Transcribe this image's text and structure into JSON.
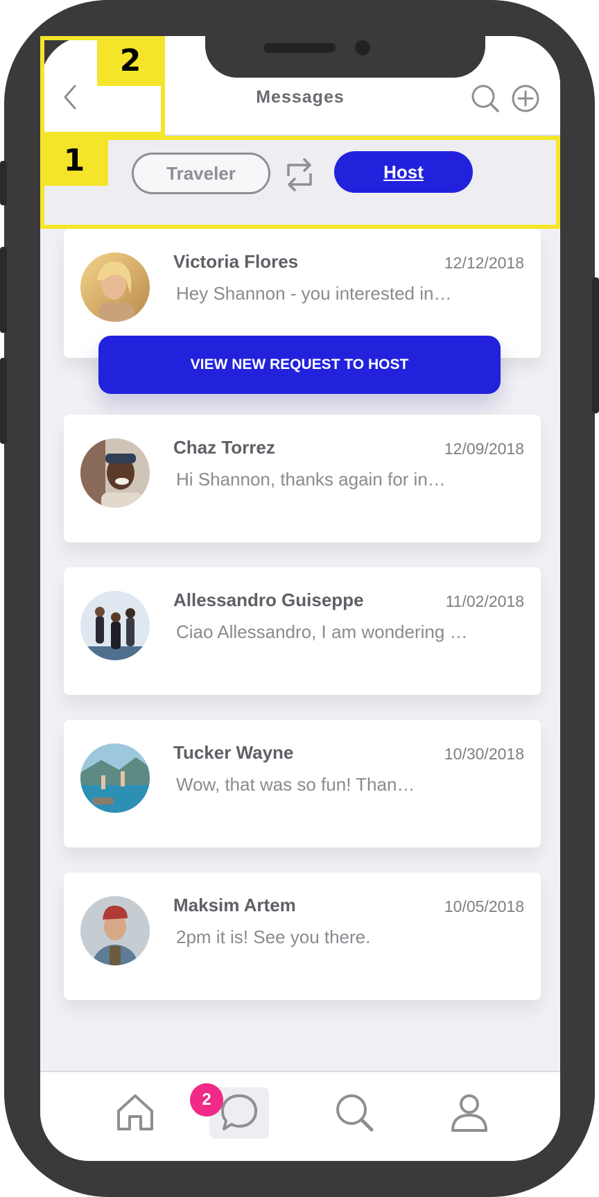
{
  "header": {
    "title": "Messages"
  },
  "toggle": {
    "traveler_label": "Traveler",
    "host_label": "Host"
  },
  "annotations": [
    {
      "label": "1"
    },
    {
      "label": "2"
    }
  ],
  "request_button": {
    "label": "VIEW NEW REQUEST TO HOST"
  },
  "conversations": [
    {
      "name": "Victoria Flores",
      "date": "12/12/2018",
      "preview": "Hey Shannon - you interested in…"
    },
    {
      "name": "Chaz Torrez",
      "date": "12/09/2018",
      "preview": "Hi Shannon, thanks again for in…"
    },
    {
      "name": "Allessandro Guiseppe",
      "date": "11/02/2018",
      "preview": "Ciao Allessandro, I am wondering …"
    },
    {
      "name": "Tucker Wayne",
      "date": "10/30/2018",
      "preview": "Wow, that was so fun! Than…"
    },
    {
      "name": "Maksim Artem",
      "date": "10/05/2018",
      "preview": "2pm it is! See you there."
    }
  ],
  "tabbar": {
    "items": [
      "home-icon",
      "chat-icon",
      "search-icon",
      "profile-icon"
    ],
    "active": "chat-icon",
    "badge_count": "2"
  },
  "colors": {
    "accent": "#2222dd",
    "badge": "#f02a86",
    "annotation": "#f5e52a"
  }
}
